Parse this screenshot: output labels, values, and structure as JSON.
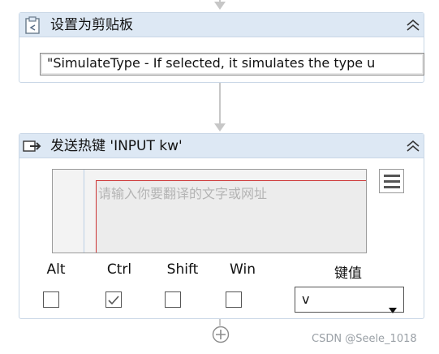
{
  "activity_set_clipboard": {
    "title": "设置为剪贴板",
    "text_value": "\"SimulateType - If selected, it simulates the type u"
  },
  "activity_send_hotkey": {
    "title": "发送热键 'INPUT  kw'",
    "input_placeholder": "请输入你要翻译的文字或网址",
    "modifiers": [
      {
        "label": "Alt",
        "checked": false
      },
      {
        "label": "Ctrl",
        "checked": true
      },
      {
        "label": "Shift",
        "checked": false
      },
      {
        "label": "Win",
        "checked": false
      }
    ],
    "key_label": "键值",
    "key_value": "v"
  },
  "watermark": "CSDN @Seele_1018",
  "icons": {
    "clipboard": "clipboard-icon",
    "hotkey": "send-hotkey-icon",
    "collapse": "chevron-double-up-icon",
    "menu": "hamburger-menu-icon",
    "dropdown": "caret-down-icon",
    "add": "add-activity-icon"
  }
}
